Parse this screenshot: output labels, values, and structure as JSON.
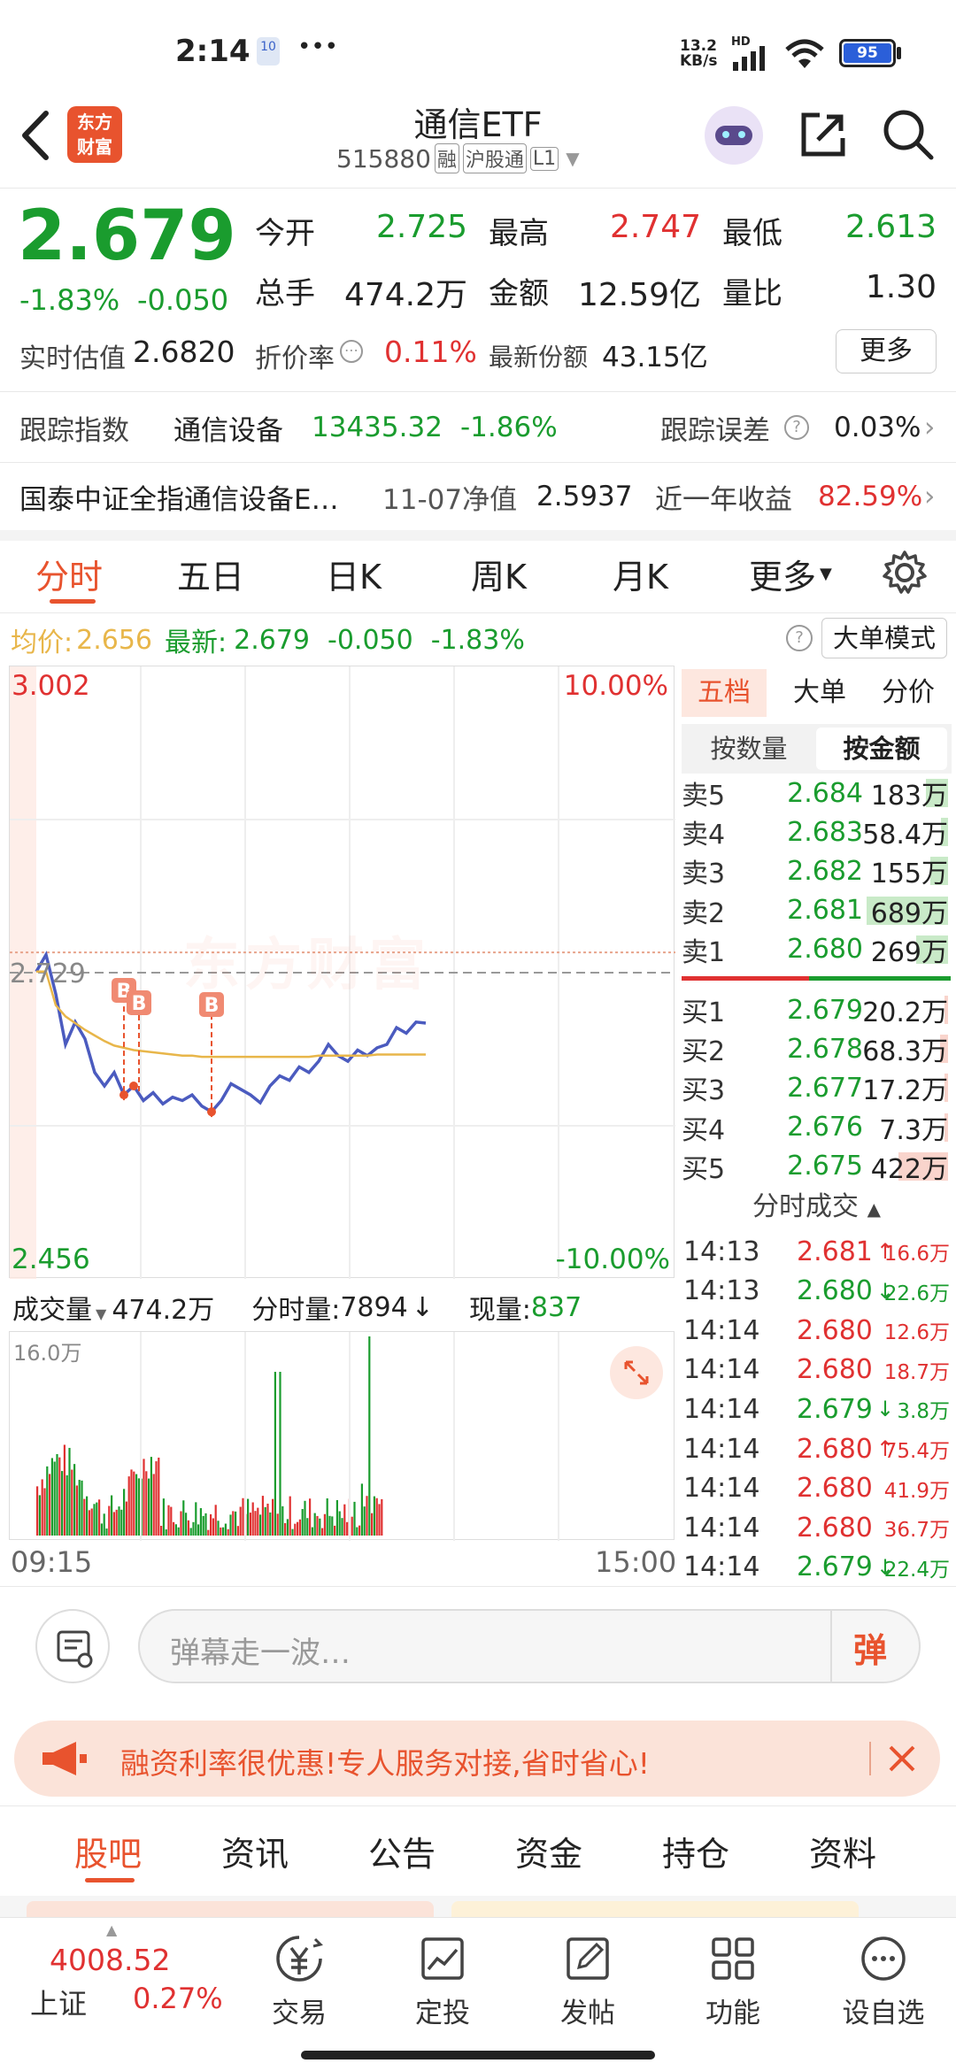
{
  "status_bar": {
    "time": "2:14",
    "notif_badge": "10",
    "more": "•••",
    "net_speed_top": "13.2",
    "net_speed_bottom": "KB/s",
    "hd": "HD",
    "battery": "95"
  },
  "header": {
    "back_icon": "chevron-left-icon",
    "app_logo_line1": "东方",
    "app_logo_line2": "财富",
    "title": "通信ETF",
    "code": "515880",
    "tag_margin": "融",
    "tag_connect": "沪股通",
    "tag_level": "L1"
  },
  "quote": {
    "price": "2.679",
    "change_pct": "-1.83%",
    "change": "-0.050",
    "open_label": "今开",
    "open": "2.725",
    "high_label": "最高",
    "high": "2.747",
    "low_label": "最低",
    "low": "2.613",
    "volume_label": "总手",
    "volume": "474.2万",
    "amount_label": "金额",
    "amount": "12.59亿",
    "ratio_label": "量比",
    "ratio": "1.30",
    "iopv_label": "实时估值",
    "iopv": "2.6820",
    "premium_label": "折价率",
    "premium": "0.11%",
    "shares_label": "最新份额",
    "shares": "43.15亿",
    "more_button": "更多"
  },
  "tracking": {
    "label": "跟踪指数",
    "index_name": "通信设备",
    "index_value": "13435.32",
    "index_change": "-1.86%",
    "error_label": "跟踪误差",
    "error_value": "0.03%"
  },
  "fund": {
    "name": "国泰中证全指通信设备E…",
    "nav_label": "11-07净值",
    "nav": "2.5937",
    "year_label": "近一年收益",
    "year_return": "82.59%"
  },
  "chart_tabs": [
    "分时",
    "五日",
    "日K",
    "周K",
    "月K",
    "更多"
  ],
  "info_line": {
    "avg_label": "均价:",
    "avg": "2.656",
    "latest_label": "最新:",
    "latest": "2.679",
    "change": "-0.050",
    "change_pct": "-1.83%",
    "big_order_button": "大单模式"
  },
  "axis": {
    "top_price": "3.002",
    "top_pct": "10.00%",
    "mid_price": "2.729",
    "bottom_price": "2.456",
    "bottom_pct": "-10.00%",
    "time_start": "09:15",
    "time_end": "15:00",
    "watermark": "东方财富"
  },
  "volume_bar": {
    "label": "成交量",
    "total": "474.2万",
    "min_label": "分时量:",
    "min_value": "7894",
    "now_label": "现量:",
    "now_value": "837",
    "scale": "16.0万"
  },
  "right_tabs": [
    "五档",
    "大单",
    "分价"
  ],
  "sub_tabs": [
    "按数量",
    "按金额"
  ],
  "order_book": {
    "asks": [
      {
        "label": "卖5",
        "price": "2.684",
        "amount": "183万",
        "fill": 0.27
      },
      {
        "label": "卖4",
        "price": "2.683",
        "amount": "58.4万",
        "fill": 0.09
      },
      {
        "label": "卖3",
        "price": "2.682",
        "amount": "155万",
        "fill": 0.22
      },
      {
        "label": "卖2",
        "price": "2.681",
        "amount": "689万",
        "fill": 1.0
      },
      {
        "label": "卖1",
        "price": "2.680",
        "amount": "269万",
        "fill": 0.39
      }
    ],
    "bids": [
      {
        "label": "买1",
        "price": "2.679",
        "amount": "20.2万",
        "fill": 0.03
      },
      {
        "label": "买2",
        "price": "2.678",
        "amount": "68.3万",
        "fill": 0.1
      },
      {
        "label": "买3",
        "price": "2.677",
        "amount": "17.2万",
        "fill": 0.02
      },
      {
        "label": "买4",
        "price": "2.676",
        "amount": "7.3万",
        "fill": 0.01
      },
      {
        "label": "买5",
        "price": "2.675",
        "amount": "422万",
        "fill": 0.61
      }
    ]
  },
  "trades_title": "分时成交",
  "trades": [
    {
      "time": "14:13",
      "price": "2.681",
      "dir": "↑",
      "vol": "16.6万",
      "c": "red"
    },
    {
      "time": "14:13",
      "price": "2.680",
      "dir": "↓",
      "vol": "22.6万",
      "c": "green"
    },
    {
      "time": "14:14",
      "price": "2.680",
      "dir": "",
      "vol": "12.6万",
      "c": "red"
    },
    {
      "time": "14:14",
      "price": "2.680",
      "dir": "",
      "vol": "18.7万",
      "c": "red"
    },
    {
      "time": "14:14",
      "price": "2.679",
      "dir": "↓",
      "vol": "3.8万",
      "c": "green"
    },
    {
      "time": "14:14",
      "price": "2.680",
      "dir": "↑",
      "vol": "75.4万",
      "c": "red"
    },
    {
      "time": "14:14",
      "price": "2.680",
      "dir": "",
      "vol": "41.9万",
      "c": "red"
    },
    {
      "time": "14:14",
      "price": "2.680",
      "dir": "",
      "vol": "36.7万",
      "c": "red"
    },
    {
      "time": "14:14",
      "price": "2.679",
      "dir": "↓",
      "vol": "22.4万",
      "c": "green"
    }
  ],
  "comment": {
    "placeholder": "弹幕走一波…",
    "send": "弹"
  },
  "banner": {
    "text": "融资利率很优惠!专人服务对接,省时省心!"
  },
  "bottom_tabs": [
    "股吧",
    "资讯",
    "公告",
    "资金",
    "持仓",
    "资料"
  ],
  "bottom_nav": {
    "index_value": "4008.52",
    "index_name": "上证",
    "index_change": "0.27%",
    "items": [
      "交易",
      "定投",
      "发帖",
      "功能",
      "设自选"
    ]
  },
  "colors": {
    "up": "#e03131",
    "down": "#1a9c2e",
    "accent": "#e8532e",
    "price_line": "#4b5bbf",
    "avg_line": "#e8b64a"
  },
  "chart_data": {
    "type": "line",
    "x_range": [
      "09:15",
      "15:00"
    ],
    "ylim": [
      2.456,
      3.002
    ],
    "prev_close": 2.729,
    "series": [
      {
        "values": [
          2.73,
          2.745,
          2.71,
          2.665,
          2.685,
          2.67,
          2.64,
          2.628,
          2.64,
          2.62,
          2.628,
          2.615,
          2.622,
          2.612,
          2.618,
          2.615,
          2.62,
          2.61,
          2.605,
          2.615,
          2.63,
          2.625,
          2.62,
          2.613,
          2.628,
          2.637,
          2.633,
          2.645,
          2.64,
          2.65,
          2.665,
          2.655,
          2.65,
          2.66,
          2.655,
          2.662,
          2.665,
          2.68,
          2.675,
          2.685,
          2.684
        ]
      },
      {
        "values": [
          2.73,
          2.73,
          2.7,
          2.69,
          2.684,
          2.678,
          2.673,
          2.668,
          2.664,
          2.662,
          2.66,
          2.659,
          2.658,
          2.657,
          2.656,
          2.655,
          2.655,
          2.654,
          2.654,
          2.654,
          2.654,
          2.654,
          2.654,
          2.654,
          2.654,
          2.654,
          2.654,
          2.654,
          2.654,
          2.655,
          2.655,
          2.655,
          2.655,
          2.655,
          2.655,
          2.656,
          2.656,
          2.656,
          2.656,
          2.656,
          2.656
        ]
      }
    ],
    "annotations": [
      "B",
      "B",
      "B"
    ]
  }
}
